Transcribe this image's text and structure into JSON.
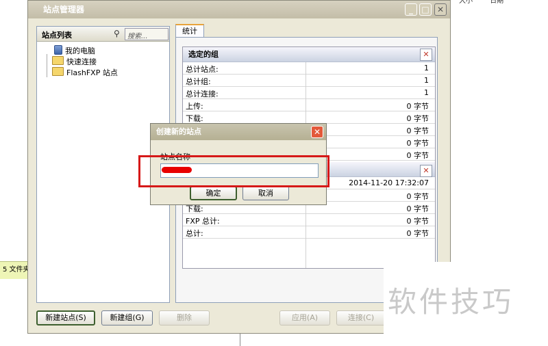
{
  "background": {
    "status_text": "5 文件夹",
    "right_columns": [
      "大小",
      "日期"
    ]
  },
  "window": {
    "title": "站点管理器",
    "btn_min": "_",
    "btn_max": "□",
    "btn_close": "✕"
  },
  "left_panel": {
    "header": "站点列表",
    "search_placeholder": "搜索...",
    "tree": [
      {
        "label": "我的电脑",
        "icon": "computer-icon"
      },
      {
        "label": "快速连接",
        "icon": "folder-icon"
      },
      {
        "label": "FlashFXP 站点",
        "icon": "folder-icon"
      }
    ]
  },
  "right_panel": {
    "tab": "统计",
    "group1": {
      "header": "选定的组",
      "rows": [
        {
          "label": "总计站点:",
          "value": "1"
        },
        {
          "label": "总计组:",
          "value": "1"
        },
        {
          "label": "总计连接:",
          "value": "1"
        },
        {
          "label": "上传:",
          "value": "0 字节"
        },
        {
          "label": "下载:",
          "value": "0 字节"
        },
        {
          "label": "",
          "value": "0 字节"
        },
        {
          "label": "",
          "value": "0 字节"
        },
        {
          "label": "",
          "value": "0 字节"
        }
      ]
    },
    "group2": {
      "rows": [
        {
          "label": "",
          "value": "2014-11-20 17:32:07"
        },
        {
          "label": "",
          "value": "0 字节"
        },
        {
          "label": "下载:",
          "value": "0 字节"
        },
        {
          "label": "FXP 总计:",
          "value": "0 字节"
        },
        {
          "label": "总计:",
          "value": "0 字节"
        }
      ]
    }
  },
  "buttons": {
    "new_site": "新建站点(S)",
    "new_group": "新建组(G)",
    "delete": "删除",
    "apply": "应用(A)",
    "connect": "连接(C)"
  },
  "dialog": {
    "title": "创建新的站点",
    "label": "站点名称",
    "ok": "确定",
    "cancel": "取消",
    "close": "✕"
  },
  "watermark": "软件技巧",
  "colors": {
    "highlight_box": "#d61818",
    "dialog_close": "#e3593a"
  }
}
